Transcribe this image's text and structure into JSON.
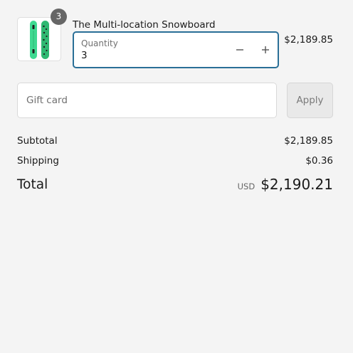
{
  "line_item": {
    "quantity_badge": "3",
    "product_name": "The Multi-location Snowboard",
    "price": "$2,189.85",
    "quantity_label": "Quantity",
    "quantity_value": "3",
    "image_icon": "snowboard-image",
    "board_colors": [
      "#3fd991",
      "#2fb872"
    ]
  },
  "gift_card": {
    "placeholder": "Gift card",
    "value": "",
    "apply_label": "Apply"
  },
  "summary": {
    "subtotal_label": "Subtotal",
    "subtotal_value": "$2,189.85",
    "shipping_label": "Shipping",
    "shipping_value": "$0.36",
    "total_label": "Total",
    "currency": "USD",
    "total_value": "$2,190.21"
  },
  "colors": {
    "background": "#f4f4f4",
    "focus_border": "#2a6f97",
    "badge": "#666666"
  }
}
